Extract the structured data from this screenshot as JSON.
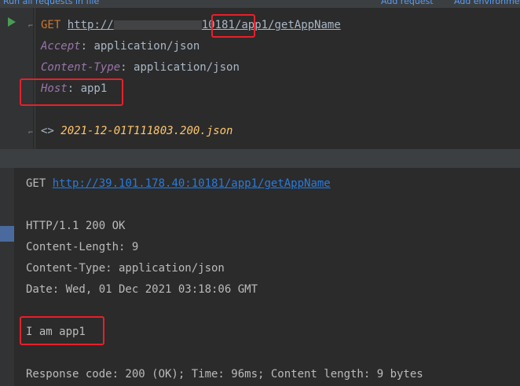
{
  "toolbar": {
    "run_all": "Run all requests in file",
    "add_request": "Add request",
    "add_environment": "Add environme"
  },
  "editor": {
    "method": "GET",
    "url_scheme": "http://",
    "url_port": "10181",
    "url_path": "/app1/getAppName",
    "headers": [
      {
        "name": "Accept",
        "value": "application/json"
      },
      {
        "name": "Content-Type",
        "value": "application/json"
      },
      {
        "name": "Host",
        "value": "app1"
      }
    ],
    "response_ref_mark": "<>",
    "response_ref": "2021-12-01T111803.200.json"
  },
  "output": {
    "request_method": "GET",
    "request_url": "http://39.101.178.40:10181/app1/getAppName",
    "status_line": "HTTP/1.1 200 OK",
    "content_length": "Content-Length: 9",
    "content_type": "Content-Type: application/json",
    "date": "Date: Wed, 01 Dec 2021 03:18:06 GMT",
    "body": "I am app1",
    "summary": "Response code: 200 (OK); Time: 96ms; Content length: 9 bytes"
  },
  "colors": {
    "background": "#2b2b2b",
    "highlight": "#e8202a",
    "keyword": "#cc7832",
    "header_name": "#9876aa",
    "link": "#287bde"
  }
}
